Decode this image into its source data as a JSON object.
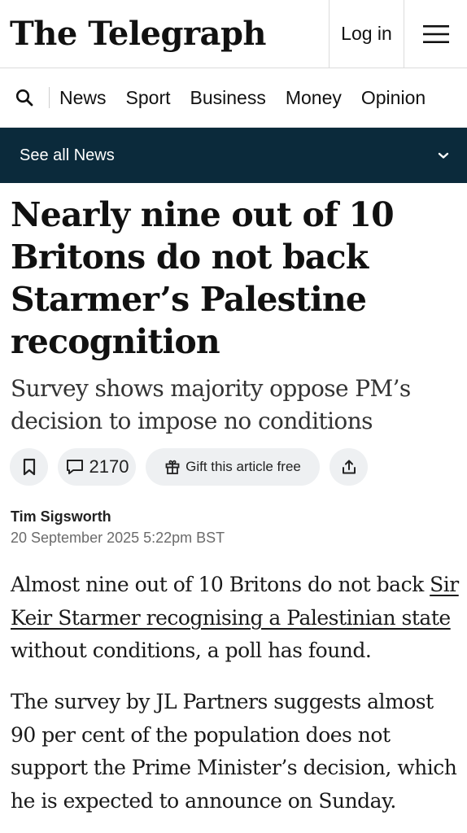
{
  "header": {
    "logo": "The Telegraph",
    "login_label": "Log in",
    "menu_icon": "hamburger-menu-icon"
  },
  "nav": {
    "search_icon": "search-icon",
    "items": [
      "News",
      "Sport",
      "Business",
      "Money",
      "Opinion"
    ]
  },
  "section_bar": {
    "label": "See all News",
    "icon": "chevron-down-icon",
    "background": "#0b2a3b"
  },
  "article": {
    "headline": "Nearly nine out of 10 Britons do not back Starmer’s Palestine recognition",
    "standfirst": "Survey shows majority oppose PM’s decision to impose no conditions",
    "actions": {
      "bookmark_icon": "bookmark-icon",
      "comment_icon": "comment-icon",
      "comment_count": "2170",
      "gift_icon": "gift-icon",
      "gift_label": "Gift this article free",
      "share_icon": "share-icon"
    },
    "author": "Tim Sigsworth",
    "date": "20 September 2025 5:22pm BST",
    "p1_before": "Almost nine out of 10 Britons do not back ",
    "p1_link": "Sir Keir Starmer recognising a Palestinian state",
    "p1_after": " without conditions, a poll has found.",
    "p2": "The survey by JL Partners suggests almost 90 per cent of the population does not support the Prime Minister’s decision, which he is expected to announce on Sunday."
  }
}
